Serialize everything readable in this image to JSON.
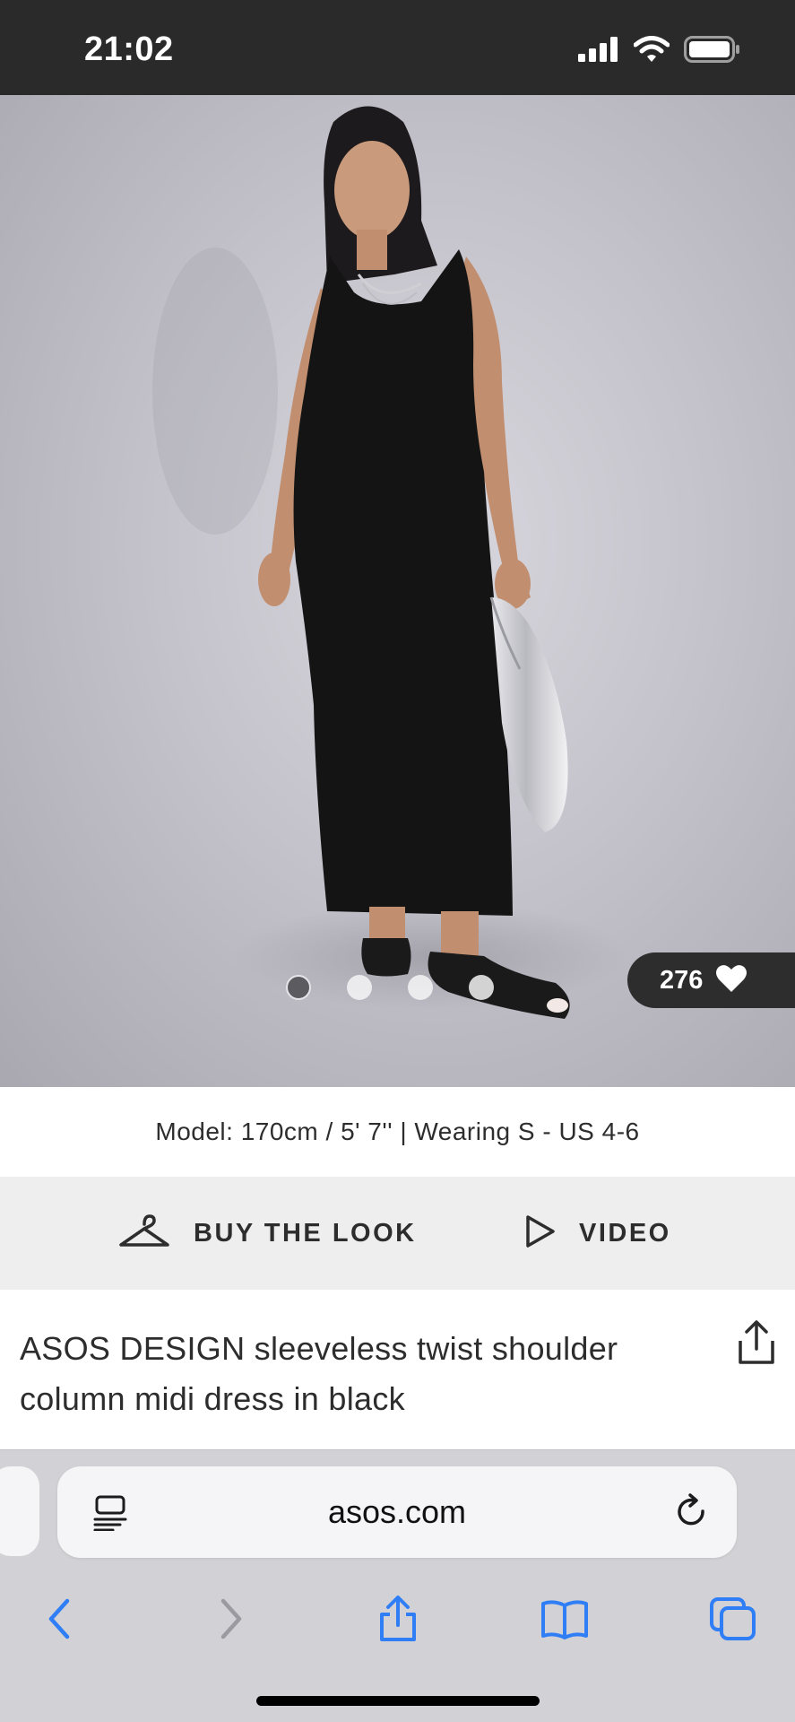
{
  "status_bar": {
    "time": "21:02",
    "icons": [
      "cellular-signal-icon",
      "wifi-icon",
      "battery-icon"
    ]
  },
  "product_gallery": {
    "dot_count": 4,
    "active_dot": 1,
    "likes": "276",
    "like_icon": "heart-icon"
  },
  "model_info": "Model: 170cm / 5' 7'' | Wearing S - US 4-6",
  "actions": {
    "buy_the_look": "BUY THE LOOK",
    "buy_the_look_icon": "hanger-icon",
    "video": "VIDEO",
    "video_icon": "play-icon"
  },
  "product": {
    "title": "ASOS DESIGN sleeveless twist shoulder column midi dress in black",
    "share_icon": "share-icon"
  },
  "browser": {
    "url": "asos.com",
    "reader_icon": "reader-mode-icon",
    "reload_icon": "reload-icon",
    "toolbar": [
      "back-icon",
      "forward-icon",
      "share-icon",
      "bookmarks-icon",
      "tabs-icon"
    ]
  },
  "colors": {
    "status_bar_bg": "#2a2a2a",
    "action_row_bg": "#eeeeee",
    "browser_chrome_bg": "#d2d2d6",
    "safari_blue": "#2f7ef6",
    "text": "#2d2d2d"
  }
}
